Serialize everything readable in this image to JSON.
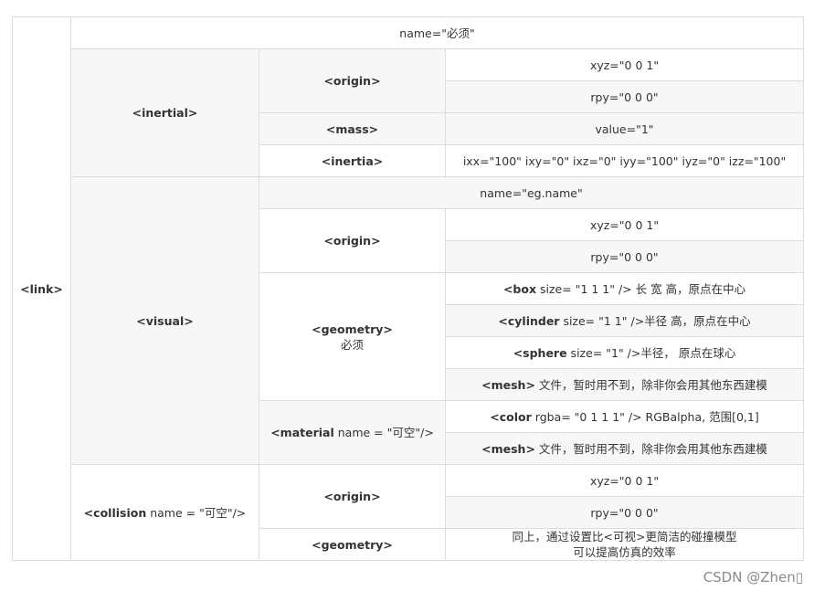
{
  "link_tag": "<link>",
  "name_row": "name=\"必须\"",
  "inertial": {
    "tag": "<inertial>",
    "origin_tag": "<origin>",
    "xyz": "xyz=\"0 0 1\"",
    "rpy": "rpy=\"0 0 0\"",
    "mass_tag": "<mass>",
    "mass_value": "value=\"1\"",
    "inertia_tag": "<inertia>",
    "inertia_value": "ixx=\"100\" ixy=\"0\" ixz=\"0\" iyy=\"100\" iyz=\"0\" izz=\"100\""
  },
  "visual": {
    "tag": "<visual>",
    "name_row": "name=\"eg.name\"",
    "origin_tag": "<origin>",
    "xyz": "xyz=\"0 0 1\"",
    "rpy": "rpy=\"0 0 0\"",
    "geometry_tag": "<geometry>",
    "geometry_note": "必须",
    "box_tag": "<box",
    "box_rest": " size= \"1 1 1\" /> 长 宽 高，原点在中心",
    "cylinder_tag": "<cylinder",
    "cylinder_rest": " size= \"1 1\" />半径 高，原点在中心",
    "sphere_tag": "<sphere",
    "sphere_rest": " size= \"1\" />半径， 原点在球心",
    "mesh_tag": "<mesh>",
    "mesh_rest": " 文件，暂时用不到，除非你会用其他东西建模",
    "material_tag": "<material",
    "material_rest": " name = \"可空\"/>",
    "color_tag": "<color",
    "color_rest": " rgba= \"0 1 1 1\" /> RGBalpha, 范围[0,1]",
    "mat_mesh_tag": "<mesh>",
    "mat_mesh_rest": " 文件，暂时用不到，除非你会用其他东西建模"
  },
  "collision": {
    "tag": "<collision",
    "tag_rest": " name = \"可空\"/>",
    "origin_tag": "<origin>",
    "xyz": "xyz=\"0 0 1\"",
    "rpy": "rpy=\"0 0 0\"",
    "geometry_tag": "<geometry>",
    "geometry_line1": "同上，通过设置比<可视>更简洁的碰撞模型",
    "geometry_line2": "可以提高仿真的效率"
  },
  "watermark": "CSDN @Zhen▯"
}
